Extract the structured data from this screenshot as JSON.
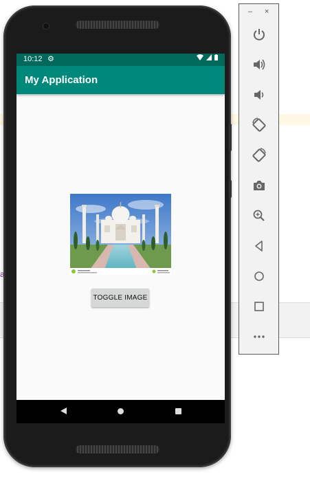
{
  "emulator": {
    "window_controls": {
      "minimize": "–",
      "close": "×"
    },
    "tools": [
      {
        "name": "power-icon"
      },
      {
        "name": "volume-up-icon"
      },
      {
        "name": "volume-down-icon"
      },
      {
        "name": "rotate-left-icon"
      },
      {
        "name": "rotate-right-icon"
      },
      {
        "name": "camera-icon"
      },
      {
        "name": "zoom-icon"
      },
      {
        "name": "back-icon"
      },
      {
        "name": "home-icon"
      },
      {
        "name": "overview-icon"
      },
      {
        "name": "more-icon"
      }
    ]
  },
  "status_bar": {
    "time": "10:12"
  },
  "app_bar": {
    "title": "My Application"
  },
  "main": {
    "toggle_button_label": "TOGGLE IMAGE"
  },
  "colors": {
    "status_bar": "#00695c",
    "app_bar": "#00897b",
    "screen_bg": "#fafafa",
    "button_bg": "#d6d7d7"
  }
}
